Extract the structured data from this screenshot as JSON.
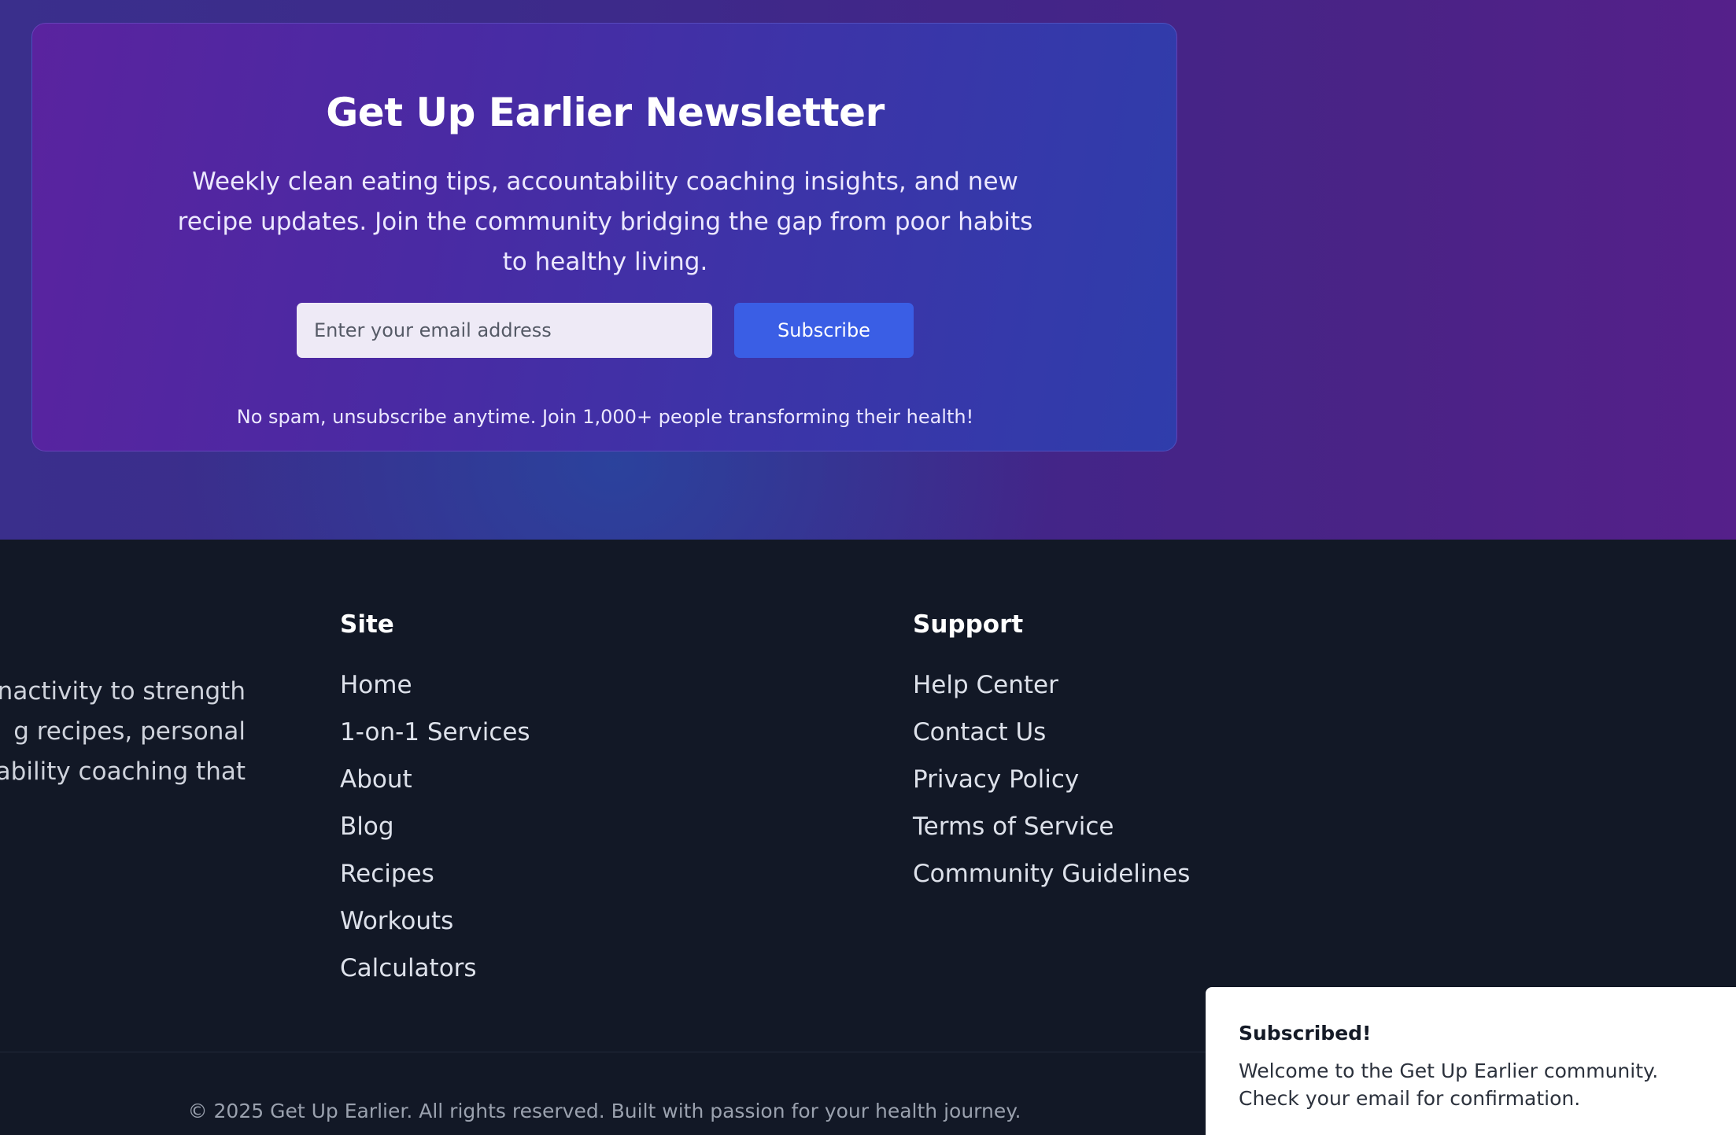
{
  "newsletter": {
    "title": "Get Up Earlier Newsletter",
    "description": "Weekly clean eating tips, accountability coaching insights, and new recipe updates. Join the community bridging the gap from poor habits to healthy living.",
    "email_placeholder": "Enter your email address",
    "subscribe_label": "Subscribe",
    "fine_print": "No spam, unsubscribe anytime. Join 1,000+ people transforming their health!"
  },
  "footer": {
    "about_lines": [
      "inactivity to strength",
      "g recipes, personal",
      "tability coaching that"
    ],
    "site": {
      "heading": "Site",
      "links": [
        "Home",
        "1-on-1 Services",
        "About",
        "Blog",
        "Recipes",
        "Workouts",
        "Calculators"
      ]
    },
    "support": {
      "heading": "Support",
      "links": [
        "Help Center",
        "Contact Us",
        "Privacy Policy",
        "Terms of Service",
        "Community Guidelines"
      ]
    },
    "copyright": "© 2025 Get Up Earlier. All rights reserved. Built with passion for your health journey."
  },
  "toast": {
    "title": "Subscribed!",
    "message": "Welcome to the Get Up Earlier community. Check your email for confirmation."
  }
}
